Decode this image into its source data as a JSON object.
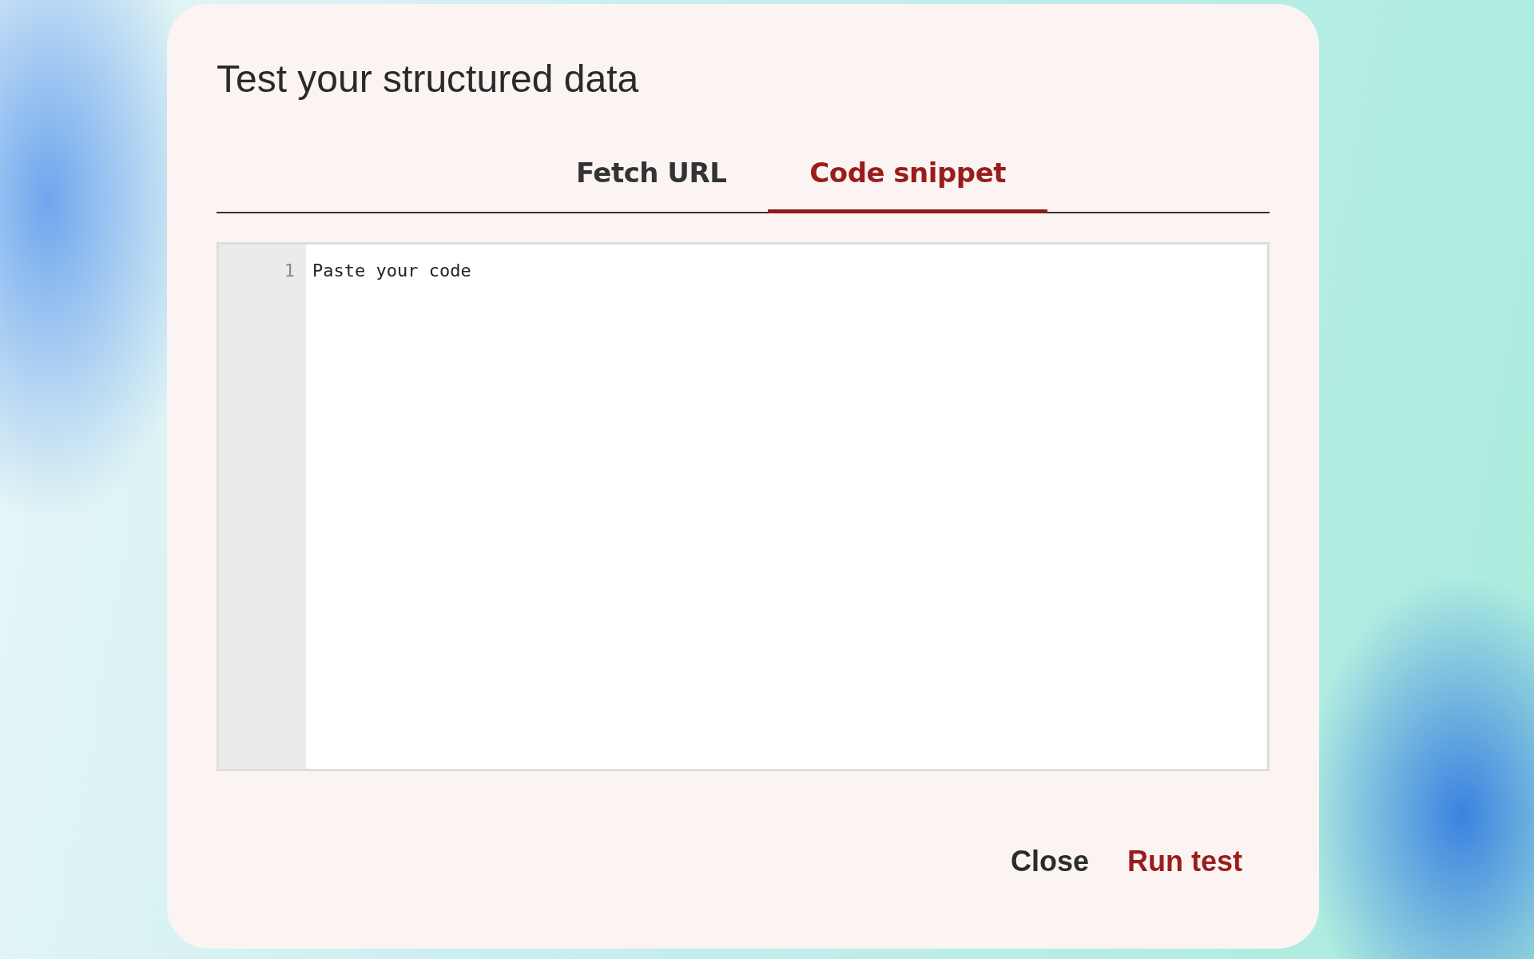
{
  "dialog": {
    "title": "Test your structured data"
  },
  "tabs": [
    {
      "label": "Fetch URL",
      "selected": false
    },
    {
      "label": "Code snippet",
      "selected": true
    }
  ],
  "editor": {
    "line_numbers": [
      "1"
    ],
    "placeholder": "Paste your code"
  },
  "buttons": [
    {
      "label": "Close",
      "kind": "secondary"
    },
    {
      "label": "Run test",
      "kind": "primary"
    }
  ]
}
